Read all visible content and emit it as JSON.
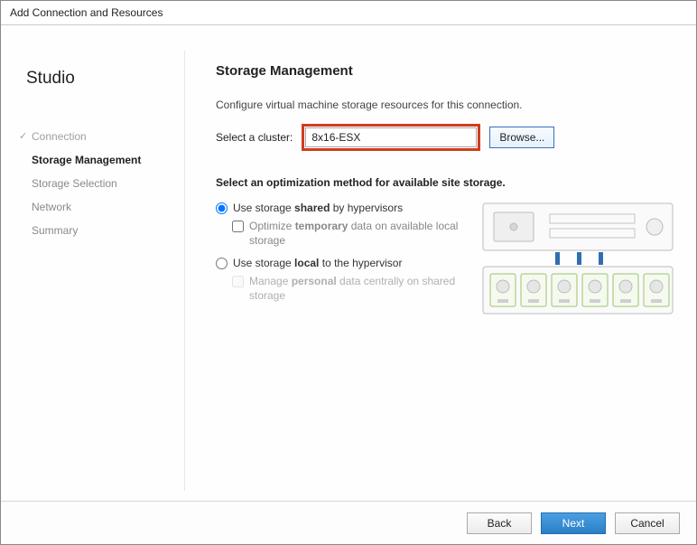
{
  "window_title": "Add Connection and Resources",
  "brand": "Studio",
  "steps": [
    {
      "label": "Connection",
      "state": "done"
    },
    {
      "label": "Storage Management",
      "state": "current"
    },
    {
      "label": "Storage Selection",
      "state": "future"
    },
    {
      "label": "Network",
      "state": "future"
    },
    {
      "label": "Summary",
      "state": "future"
    }
  ],
  "main": {
    "heading": "Storage Management",
    "description": "Configure virtual machine storage resources for this connection.",
    "cluster_label": "Select a cluster:",
    "cluster_value": "8x16-ESX",
    "browse_label": "Browse...",
    "method_heading": "Select an optimization method for available site storage.",
    "opt1_pre": "Use storage ",
    "opt1_bold": "shared",
    "opt1_post": " by hypervisors",
    "opt1_selected": true,
    "opt1_sub_pre": "Optimize ",
    "opt1_sub_bold": "temporary",
    "opt1_sub_post": " data on available local storage",
    "opt2_pre": "Use storage ",
    "opt2_bold": "local",
    "opt2_post": " to the hypervisor",
    "opt2_sub_pre": "Manage ",
    "opt2_sub_bold": "personal",
    "opt2_sub_post": " data centrally on shared storage"
  },
  "buttons": {
    "back": "Back",
    "next": "Next",
    "cancel": "Cancel"
  }
}
